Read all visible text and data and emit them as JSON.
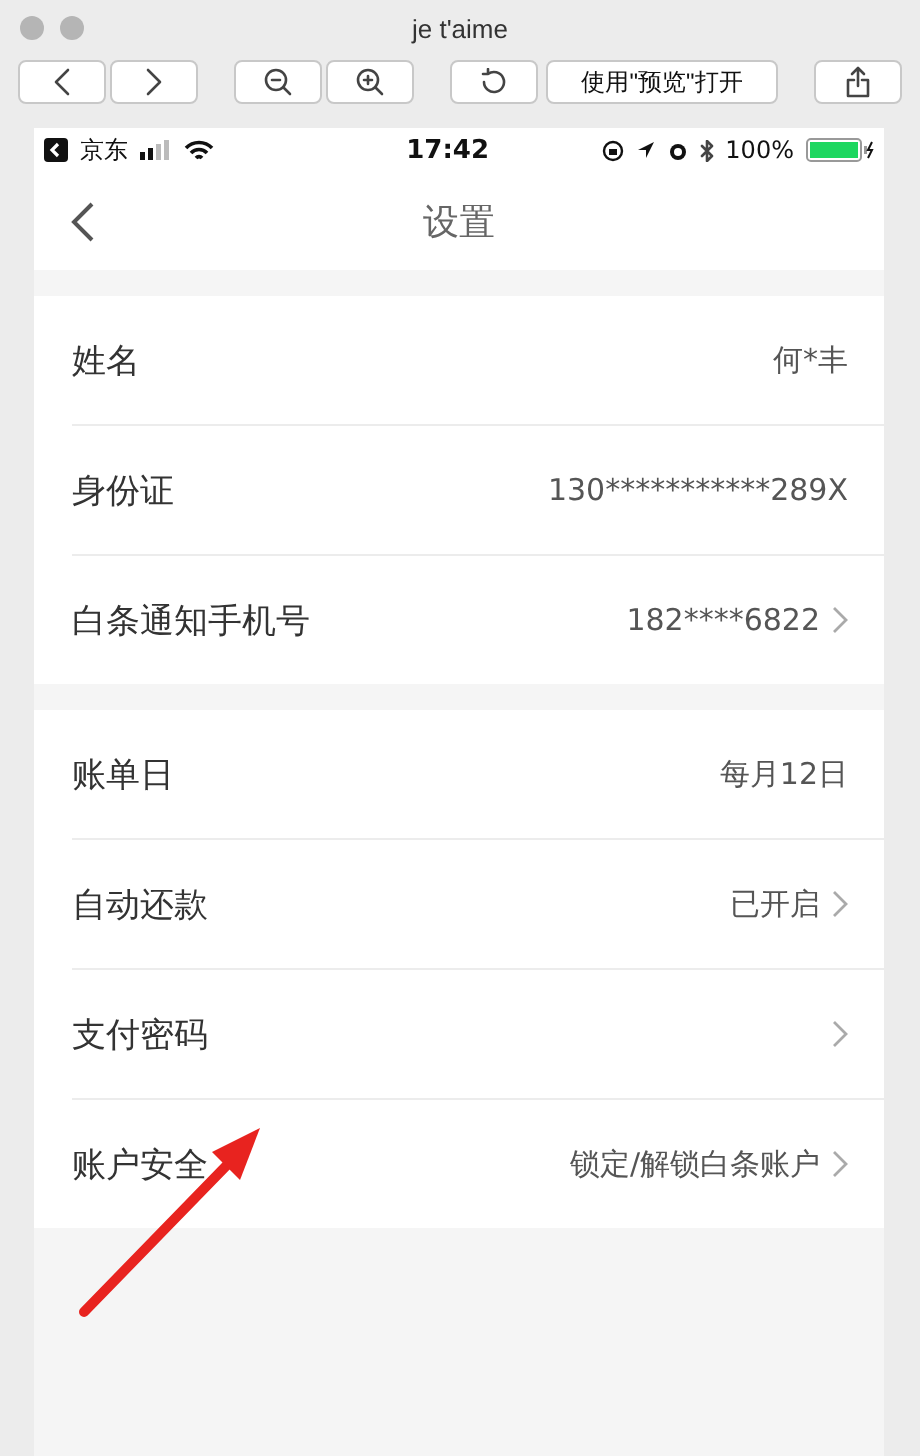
{
  "window": {
    "title": "je t'aime"
  },
  "toolbar": {
    "open_with_button": "使用\"预览\"打开"
  },
  "status_bar": {
    "carrier": "京东",
    "time": "17:42",
    "battery": "100%"
  },
  "nav": {
    "title": "设置"
  },
  "sections": [
    {
      "rows": [
        {
          "label": "姓名",
          "value": "何*丰",
          "chevron": false
        },
        {
          "label": "身份证",
          "value": "130***********289X",
          "chevron": false
        },
        {
          "label": "白条通知手机号",
          "value": "182****6822",
          "chevron": true
        }
      ]
    },
    {
      "rows": [
        {
          "label": "账单日",
          "value": "每月12日",
          "chevron": false
        },
        {
          "label": "自动还款",
          "value": "已开启",
          "chevron": true
        },
        {
          "label": "支付密码",
          "value": "",
          "chevron": true
        },
        {
          "label": "账户安全",
          "value": "锁定/解锁白条账户",
          "chevron": true
        }
      ]
    }
  ]
}
